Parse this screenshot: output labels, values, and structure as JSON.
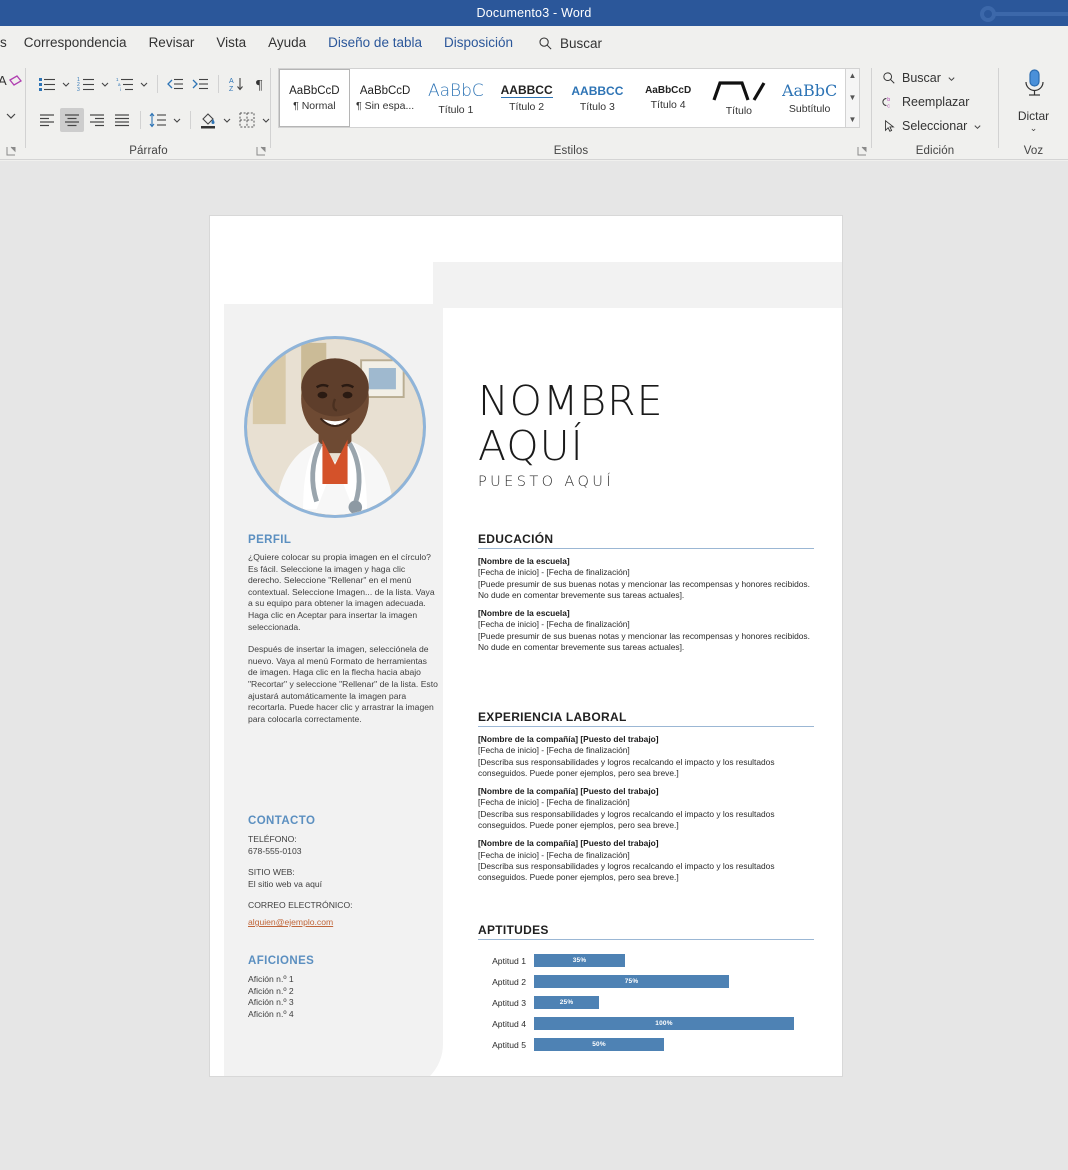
{
  "window": {
    "title": "Documento3  -  Word"
  },
  "ribbon": {
    "tabs": [
      {
        "label": "s",
        "accent": false
      },
      {
        "label": "Correspondencia",
        "accent": false
      },
      {
        "label": "Revisar",
        "accent": false
      },
      {
        "label": "Vista",
        "accent": false
      },
      {
        "label": "Ayuda",
        "accent": false
      },
      {
        "label": "Diseño de tabla",
        "accent": true
      },
      {
        "label": "Disposición",
        "accent": true
      }
    ],
    "search": {
      "label": "Buscar",
      "icon": "search-icon"
    },
    "groups": {
      "paragraph": {
        "label": "Párrafo"
      },
      "styles": {
        "label": "Estilos"
      },
      "editing": {
        "label": "Edición"
      },
      "voice": {
        "label": "Voz"
      }
    },
    "styles_gallery": [
      {
        "preview": "AaBbCcD",
        "name": "¶ Normal",
        "active": true
      },
      {
        "preview": "AaBbCcD",
        "name": "¶ Sin espa...",
        "active": false
      },
      {
        "preview": "AaBbC",
        "name": "Título 1",
        "active": false
      },
      {
        "preview": "AABBCC",
        "name": "Título 2",
        "active": false
      },
      {
        "preview": "AABBCC",
        "name": "Título 3",
        "active": false
      },
      {
        "preview": "AaBbCcD",
        "name": "Título 4",
        "active": false
      },
      {
        "preview": "",
        "name": "Título",
        "active": false
      },
      {
        "preview": "AaBbC",
        "name": "Subtítulo",
        "active": false
      }
    ],
    "editing_items": [
      {
        "label": "Buscar",
        "icon": "search-icon",
        "caret": true
      },
      {
        "label": "Reemplazar",
        "icon": "replace-icon",
        "caret": false
      },
      {
        "label": "Seleccionar",
        "icon": "cursor-arrow-icon",
        "caret": true
      }
    ],
    "dictate": {
      "label": "Dictar",
      "icon": "microphone-icon"
    }
  },
  "colors": {
    "title_bar": "#2b579a",
    "accent_tab": "#2b579a",
    "resume_heading": "#5b8fc0",
    "skill_bar": "#4e82b4",
    "link": "#c0663a",
    "avatar_ring": "#8fb4d9",
    "panel_grey": "#f2f2f2"
  },
  "resume": {
    "name_line1": "NOMBRE",
    "name_line2": "AQUÍ",
    "role": "PUESTO AQUÍ",
    "sidebar": {
      "profile": {
        "heading": "PERFIL",
        "paragraph1": "¿Quiere colocar su propia imagen en el círculo? Es fácil. Seleccione la imagen y haga clic derecho. Seleccione \"Rellenar\" en el menú contextual. Seleccione Imagen... de la lista. Vaya a su equipo para obtener la imagen adecuada. Haga clic en Aceptar para insertar la imagen seleccionada.",
        "paragraph2": "Después de insertar la imagen, selecciónela de nuevo. Vaya al menú Formato de herramientas de imagen. Haga clic en la flecha hacia abajo \"Recortar\" y seleccione \"Rellenar\" de la lista. Esto ajustará automáticamente la imagen para recortarla. Puede hacer clic y arrastrar la imagen para colocarla correctamente."
      },
      "contact": {
        "heading": "CONTACTO",
        "phone_label": "TELÉFONO:",
        "phone_value": "678-555-0103",
        "website_label": "SITIO WEB:",
        "website_value": "El sitio web va aquí",
        "email_label": "CORREO ELECTRÓNICO:",
        "email_value": "alguien@ejemplo.com"
      },
      "hobbies": {
        "heading": "AFICIONES",
        "items": [
          "Afición n.º 1",
          "Afición n.º 2",
          "Afición n.º 3",
          "Afición n.º 4"
        ]
      }
    },
    "education": {
      "heading": "EDUCACIÓN",
      "entries": [
        {
          "title": "[Nombre de la escuela]",
          "dates": "[Fecha de inicio] - [Fecha de finalización]",
          "body": "[Puede presumir de sus buenas notas y mencionar las recompensas y honores recibidos. No dude en comentar brevemente sus tareas actuales]."
        },
        {
          "title": "[Nombre de la escuela]",
          "dates": "[Fecha de inicio] - [Fecha de finalización]",
          "body": "[Puede presumir de sus buenas notas y mencionar las recompensas y honores recibidos. No dude en comentar brevemente sus tareas actuales]."
        }
      ]
    },
    "experience": {
      "heading": "EXPERIENCIA LABORAL",
      "entries": [
        {
          "title": "[Nombre de la compañía] [Puesto del trabajo]",
          "dates": "[Fecha de inicio] - [Fecha de finalización]",
          "body": "[Describa sus responsabilidades y logros recalcando el impacto y los resultados conseguidos. Puede poner ejemplos, pero sea breve.]"
        },
        {
          "title": "[Nombre de la compañía] [Puesto del trabajo]",
          "dates": "[Fecha de inicio] - [Fecha de finalización]",
          "body": "[Describa sus responsabilidades y logros recalcando el impacto y los resultados conseguidos. Puede poner ejemplos, pero sea breve.]"
        },
        {
          "title": "[Nombre de la compañía] [Puesto del trabajo]",
          "dates": "[Fecha de inicio] - [Fecha de finalización]",
          "body": "[Describa sus responsabilidades y logros recalcando el impacto y los resultados conseguidos. Puede poner ejemplos, pero sea breve.]"
        }
      ]
    },
    "skills": {
      "heading": "APTITUDES"
    }
  },
  "chart_data": {
    "type": "bar",
    "title": "APTITUDES",
    "orientation": "horizontal",
    "categories": [
      "Aptitud 1",
      "Aptitud 2",
      "Aptitud 3",
      "Aptitud 4",
      "Aptitud 5"
    ],
    "values": [
      35,
      75,
      25,
      100,
      50
    ],
    "labels": [
      "35%",
      "75%",
      "25%",
      "100%",
      "50%"
    ],
    "xlabel": "",
    "ylabel": "",
    "xlim": [
      0,
      100
    ],
    "grid": false,
    "legend": false,
    "bar_color": "#4e82b4",
    "label_color": "#ffffff"
  }
}
